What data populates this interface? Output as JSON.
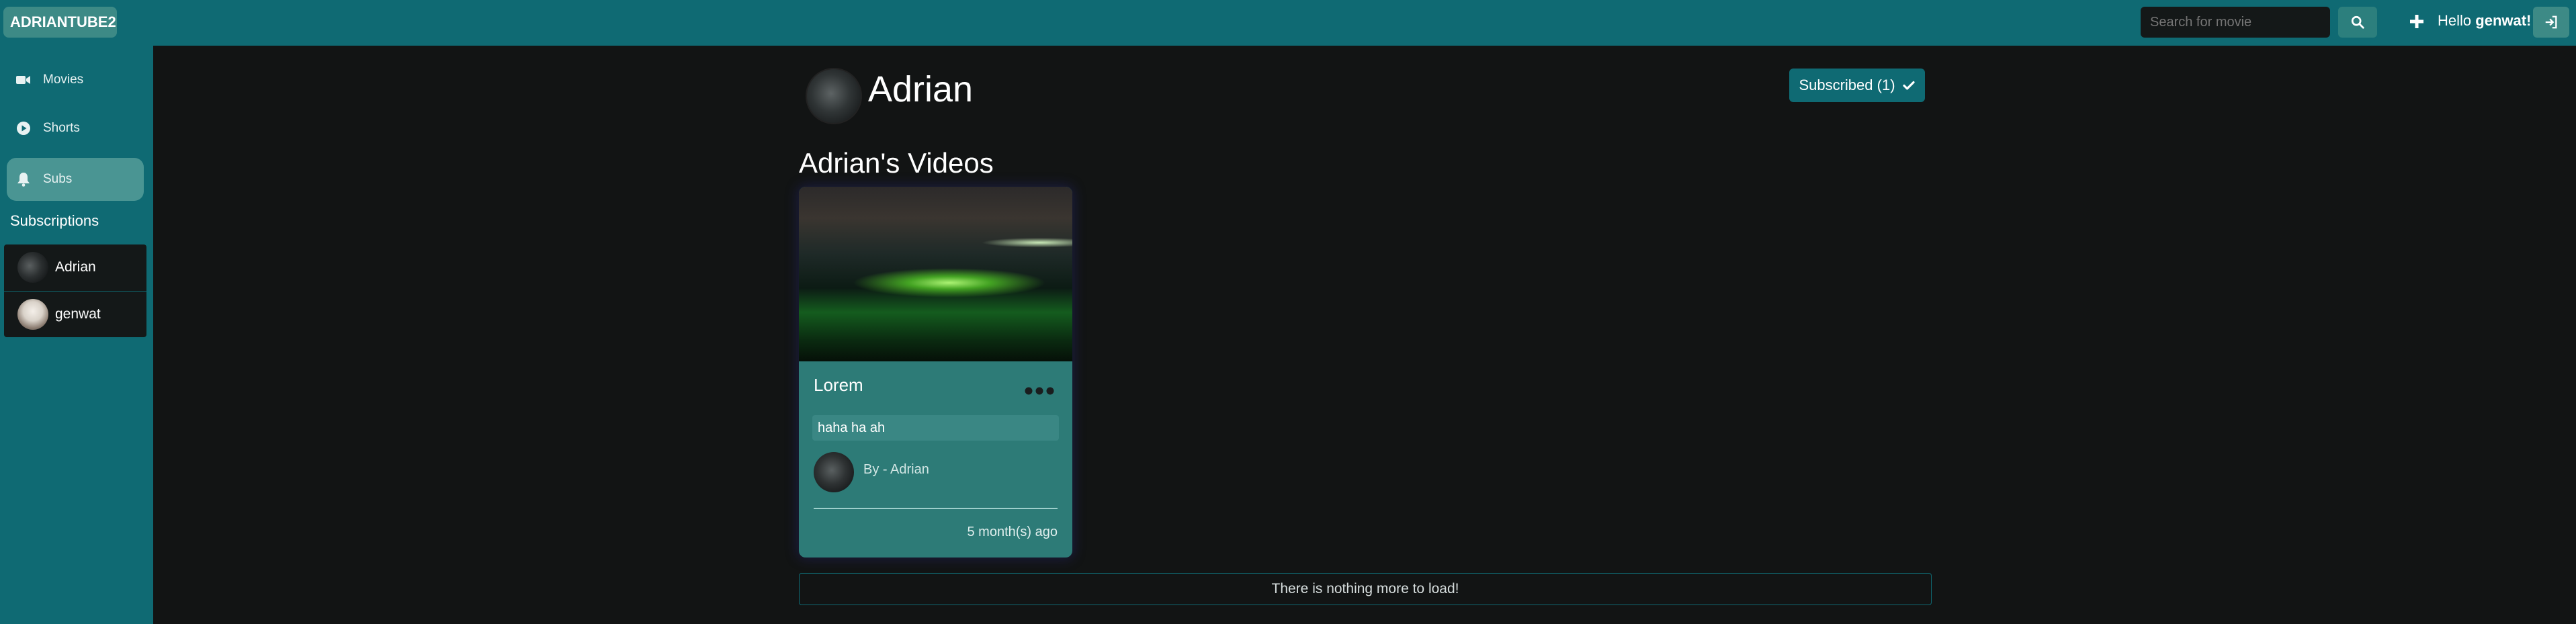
{
  "header": {
    "brand": "ADRIANTUBE2",
    "search_placeholder": "Search for movie",
    "greeting_prefix": "Hello",
    "username": "genwat!",
    "accent_color": "#0f6a73"
  },
  "sidebar": {
    "items": [
      {
        "label": "Movies",
        "icon": "video-camera-icon"
      },
      {
        "label": "Shorts",
        "icon": "play-circle-icon"
      },
      {
        "label": "Subs",
        "icon": "bell-icon",
        "active": true
      }
    ],
    "subscriptions_title": "Subscriptions",
    "subscriptions": [
      {
        "name": "Adrian"
      },
      {
        "name": "genwat"
      }
    ]
  },
  "channel": {
    "name": "Adrian",
    "subscribe_label": "Subscribed (1)",
    "videos_title": "Adrian's Videos"
  },
  "videos": [
    {
      "title": "Lorem",
      "description": "haha ha ah",
      "author": "By - Adrian",
      "time": "5 month(s) ago"
    }
  ],
  "footer_message": "There is nothing more to load!"
}
